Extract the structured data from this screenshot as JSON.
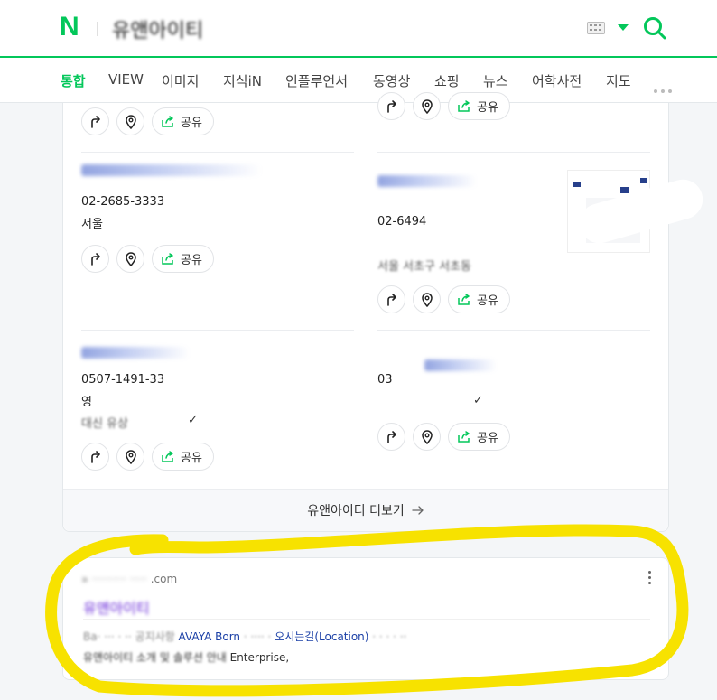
{
  "header": {
    "logo": "N",
    "query": "유앤아이티",
    "colors": {
      "brand": "#03c75a",
      "highlight": "#f7e200"
    }
  },
  "tabs": [
    {
      "label": "통합"
    },
    {
      "label": "VIEW"
    },
    {
      "label": "이미지"
    },
    {
      "label": "지식iN"
    },
    {
      "label": "인플루언서"
    },
    {
      "label": "동영상"
    },
    {
      "label": "쇼핑"
    },
    {
      "label": "뉴스"
    },
    {
      "label": "어학사전"
    },
    {
      "label": "지도"
    }
  ],
  "places": [
    {
      "phone": "",
      "address": "",
      "extra": ""
    },
    {
      "phone": "",
      "address": "",
      "extra": ""
    },
    {
      "phone": "02-2685-3333",
      "address": "서울",
      "extra": ""
    },
    {
      "phone": "02-6494",
      "address": "서울 서초구 서초동",
      "extra": ""
    },
    {
      "phone": "0507-1491-33",
      "address": "영",
      "extra": "대신 유상"
    },
    {
      "phone": "03",
      "address": "",
      "extra": ""
    }
  ],
  "actions": {
    "share_label": "공유"
  },
  "more": {
    "label": "유앤아이티 더보기"
  },
  "web_result": {
    "url_suffix": ".com",
    "title": "유앤아이티",
    "links": [
      "AVAYA Born",
      "오시는길(Location)"
    ],
    "desc_blur": "유앤아이티 소개 및 솔루션 안내",
    "desc_visible": "Enterprise,"
  }
}
